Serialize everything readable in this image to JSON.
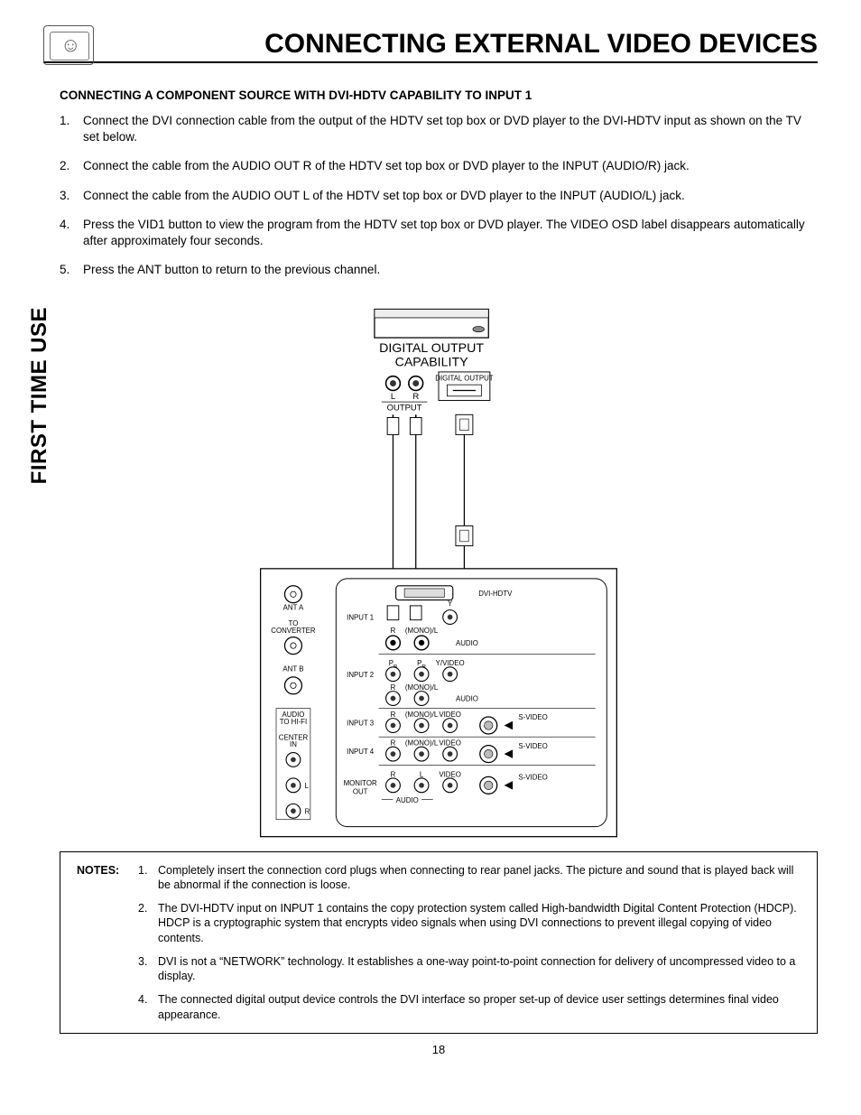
{
  "header": {
    "title": "CONNECTING EXTERNAL VIDEO DEVICES"
  },
  "sidebar": {
    "label": "FIRST TIME USE"
  },
  "section": {
    "subheading": "CONNECTING A COMPONENT SOURCE WITH DVI-HDTV CAPABILITY TO INPUT 1",
    "steps": [
      "Connect the DVI connection cable from the output of the HDTV set top box or DVD player to the DVI-HDTV input as shown on the TV set below.",
      "Connect the cable from the AUDIO OUT R of the HDTV set top box or DVD player to the INPUT (AUDIO/R) jack.",
      "Connect the cable from the AUDIO OUT L of the HDTV set top box or DVD  player to the INPUT (AUDIO/L) jack.",
      "Press the VID1 button to view the program from the HDTV set top box or DVD player.  The VIDEO OSD label disappears automatically after approximately four seconds.",
      "Press the ANT button to return to the previous channel."
    ]
  },
  "diagram": {
    "top_label_1": "DIGITAL OUTPUT",
    "top_label_2": "CAPABILITY",
    "digital_output_box": "DIGITAL OUTPUT",
    "lr_L": "L",
    "lr_R": "R",
    "output": "OUTPUT",
    "ant_a": "ANT A",
    "to_converter_1": "TO",
    "to_converter_2": "CONVERTER",
    "ant_b": "ANT B",
    "dvi_hdtv": "DVI-HDTV",
    "input1": "INPUT 1",
    "input2": "INPUT 2",
    "input3": "INPUT 3",
    "input4": "INPUT 4",
    "monitor_out": "MONITOR\nOUT",
    "audio_to_hifi_1": "AUDIO",
    "audio_to_hifi_2": "TO HI-FI",
    "center_in_1": "CENTER",
    "center_in_2": "IN",
    "y": "Y",
    "r": "R",
    "mono_l": "(MONO)/L",
    "audio": "AUDIO",
    "pb": "P",
    "pr": "P",
    "b_sub": "B",
    "r_sub": "R",
    "y_video": "Y/VIDEO",
    "video": "VIDEO",
    "s_video": "S-VIDEO",
    "l": "L",
    "audio_footer": "AUDIO"
  },
  "notes": {
    "label": "NOTES:",
    "items": [
      "Completely insert the connection cord plugs when connecting to rear panel jacks.  The picture and sound that is played back will be abnormal if the connection is loose.",
      "The DVI-HDTV input on INPUT 1 contains the copy protection system called High-bandwidth Digital Content Protection (HDCP).  HDCP is a cryptographic system that encrypts video signals when using DVI connections to prevent illegal copying of video contents.",
      "DVI is not a “NETWORK” technology.  It establishes a one-way point-to-point connection for delivery of uncompressed video to a display.",
      "The connected digital output device controls the DVI interface so proper set-up of device user settings determines final video appearance."
    ]
  },
  "page_number": "18"
}
